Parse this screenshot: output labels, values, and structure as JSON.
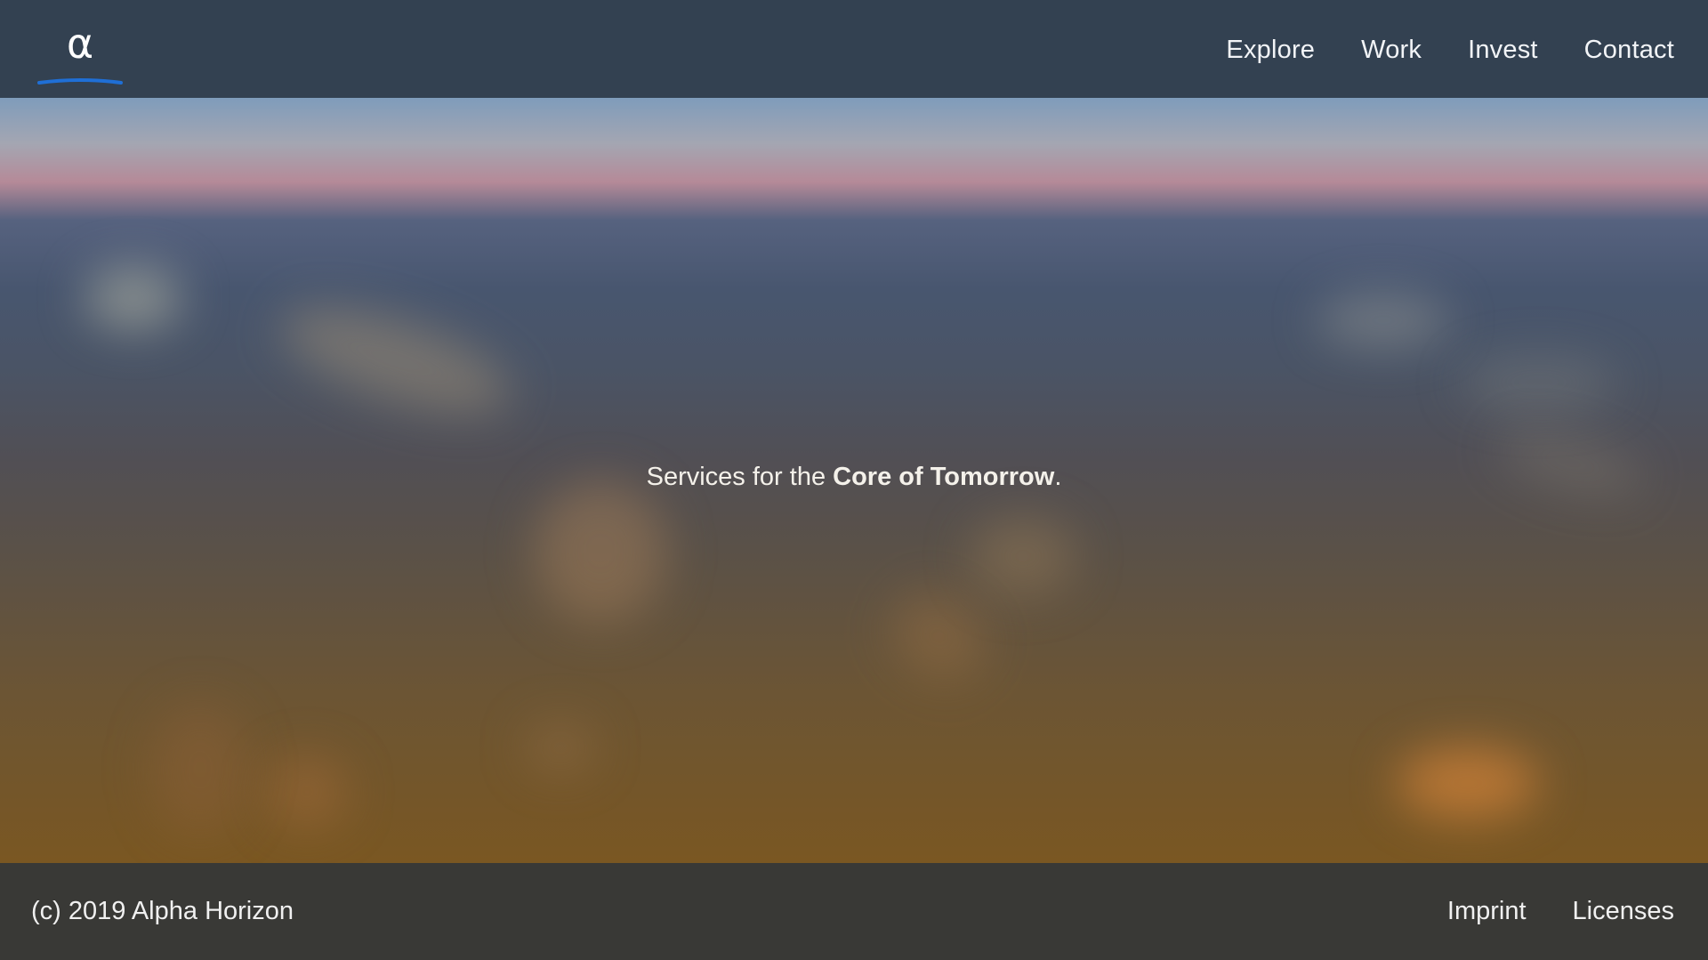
{
  "header": {
    "logo_glyph": "α",
    "nav": [
      "Explore",
      "Work",
      "Invest",
      "Contact"
    ]
  },
  "hero": {
    "tagline_prefix": "Services for the ",
    "tagline_emphasis": "Core of Tomorrow",
    "tagline_suffix": "."
  },
  "footer": {
    "copyright": "(c) 2019 Alpha Horizon",
    "links": [
      "Imprint",
      "Licenses"
    ]
  },
  "colors": {
    "header_bg": "#334151",
    "footer_bg": "#393936",
    "logo_accent": "#1f6fd6",
    "text": "#f2f4f7"
  }
}
